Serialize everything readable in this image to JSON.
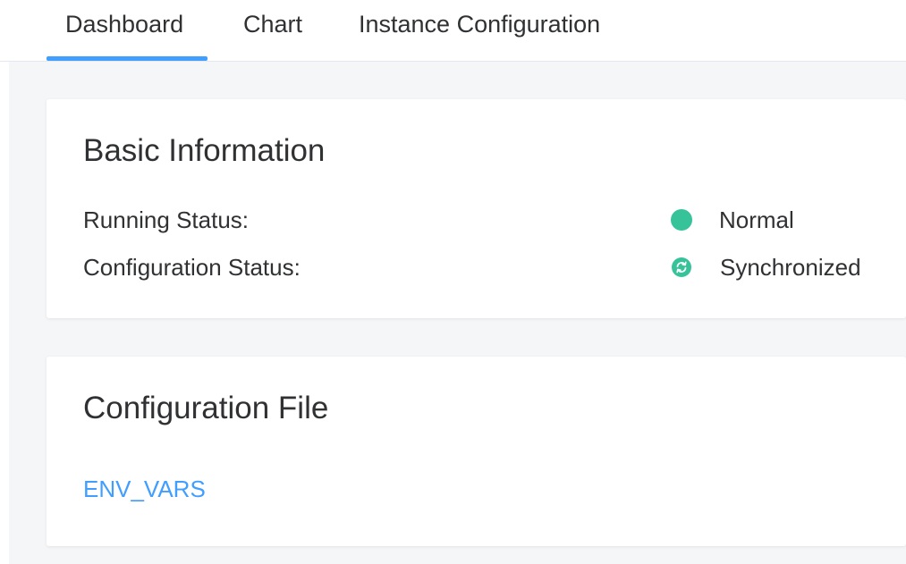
{
  "tabs": [
    {
      "label": "Dashboard",
      "active": true
    },
    {
      "label": "Chart",
      "active": false
    },
    {
      "label": "Instance Configuration",
      "active": false
    }
  ],
  "basic_info": {
    "title": "Basic Information",
    "running_status_label": "Running Status:",
    "running_status_value": "Normal",
    "configuration_status_label": "Configuration Status:",
    "configuration_status_value": "Synchronized"
  },
  "config_file": {
    "title": "Configuration File",
    "link": "ENV_VARS"
  },
  "colors": {
    "accent": "#409eff",
    "status_ok": "#36c39a",
    "background": "#f5f6f7"
  },
  "icons": {
    "running_status": "status-dot-icon",
    "configuration_status": "sync-icon"
  }
}
